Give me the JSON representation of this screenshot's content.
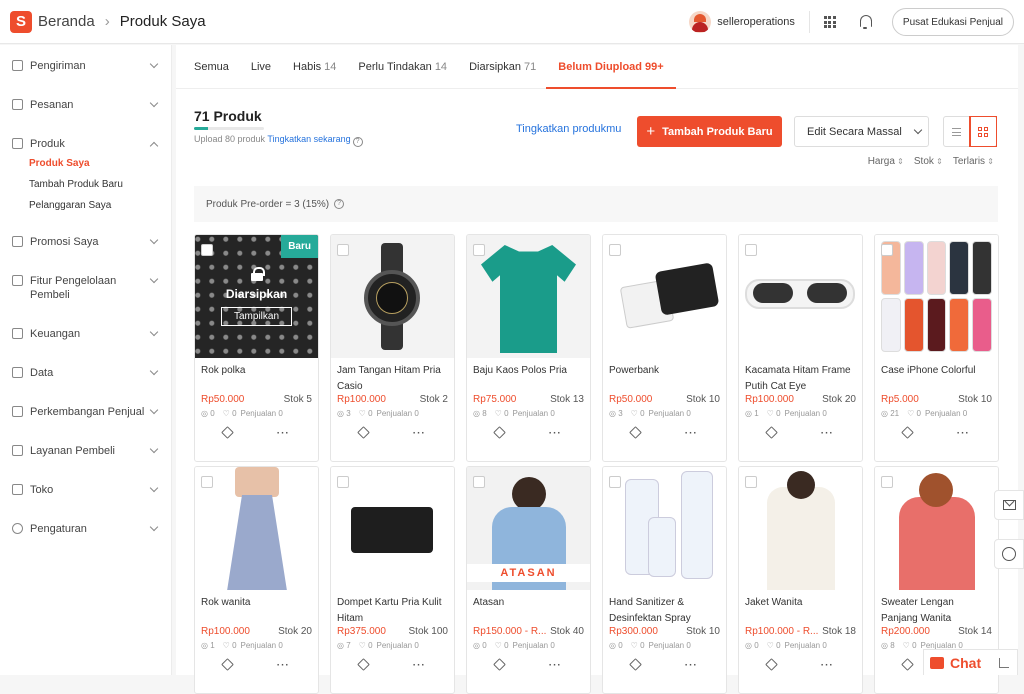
{
  "header": {
    "breadcrumb_home": "Beranda",
    "breadcrumb_current": "Produk Saya",
    "username": "selleroperations",
    "edu_button": "Pusat Edukasi Penjual"
  },
  "sidebar": {
    "items": [
      {
        "label": "Pengiriman"
      },
      {
        "label": "Pesanan"
      },
      {
        "label": "Produk",
        "sub": [
          "Produk Saya",
          "Tambah Produk Baru",
          "Pelanggaran Saya"
        ]
      },
      {
        "label": "Promosi Saya"
      },
      {
        "label": "Fitur Pengelolaan Pembeli"
      },
      {
        "label": "Keuangan"
      },
      {
        "label": "Data"
      },
      {
        "label": "Perkembangan Penjual"
      },
      {
        "label": "Layanan Pembeli"
      },
      {
        "label": "Toko"
      },
      {
        "label": "Pengaturan"
      }
    ]
  },
  "tabs": [
    {
      "label": "Semua",
      "count": ""
    },
    {
      "label": "Live",
      "count": ""
    },
    {
      "label": "Habis",
      "count": "14"
    },
    {
      "label": "Perlu Tindakan",
      "count": "14"
    },
    {
      "label": "Diarsipkan",
      "count": "71"
    },
    {
      "label": "Belum Diupload 99+",
      "count": ""
    }
  ],
  "summary": {
    "title": "71 Produk",
    "upload_progress": 0.2,
    "upload_text": "Upload 80 produk",
    "upgrade_link": "Tingkatkan sekarang",
    "upgrade_products": "Tingkatkan produkmu",
    "add_button": "Tambah Produk Baru",
    "mass_edit": "Edit Secara Massal",
    "sort": [
      "Harga",
      "Stok",
      "Terlaris"
    ],
    "preorder": "Produk Pre-order = 3 (15%)"
  },
  "archived": {
    "label": "Diarsipkan",
    "button": "Tampilkan",
    "badge": "Baru"
  },
  "products": [
    {
      "name": "Rok polka",
      "price": "Rp50.000",
      "stock": "Stok 5",
      "views": "0",
      "likes": "0",
      "sales": "Penjualan 0"
    },
    {
      "name": "Jam Tangan Hitam Pria Casio",
      "price": "Rp100.000",
      "stock": "Stok 2",
      "views": "3",
      "likes": "0",
      "sales": "Penjualan 0"
    },
    {
      "name": "Baju Kaos Polos Pria",
      "price": "Rp75.000",
      "stock": "Stok 13",
      "views": "8",
      "likes": "0",
      "sales": "Penjualan 0"
    },
    {
      "name": "Powerbank",
      "price": "Rp50.000",
      "stock": "Stok 10",
      "views": "3",
      "likes": "0",
      "sales": "Penjualan 0"
    },
    {
      "name": "Kacamata Hitam Frame Putih Cat Eye",
      "price": "Rp100.000",
      "stock": "Stok 20",
      "views": "1",
      "likes": "0",
      "sales": "Penjualan 0"
    },
    {
      "name": "Case iPhone Colorful",
      "price": "Rp5.000",
      "stock": "Stok 10",
      "views": "21",
      "likes": "0",
      "sales": "Penjualan 0"
    },
    {
      "name": "Rok wanita",
      "price": "Rp100.000",
      "stock": "Stok 20",
      "views": "1",
      "likes": "0",
      "sales": "Penjualan 0"
    },
    {
      "name": "Dompet Kartu Pria Kulit Hitam",
      "price": "Rp375.000",
      "stock": "Stok 100",
      "views": "7",
      "likes": "0",
      "sales": "Penjualan 0"
    },
    {
      "name": "Atasan",
      "price": "Rp150.000 - R...",
      "stock": "Stok 40",
      "views": "0",
      "likes": "0",
      "sales": "Penjualan 0"
    },
    {
      "name": "Hand Sanitizer & Desinfektan Spray",
      "price": "Rp300.000",
      "stock": "Stok 10",
      "views": "0",
      "likes": "0",
      "sales": "Penjualan 0"
    },
    {
      "name": "Jaket Wanita",
      "price": "Rp100.000 - R...",
      "stock": "Stok 18",
      "views": "0",
      "likes": "0",
      "sales": "Penjualan 0"
    },
    {
      "name": "Sweater Lengan Panjang Wanita",
      "price": "Rp200.000",
      "stock": "Stok 14",
      "views": "8",
      "likes": "0",
      "sales": "Penjualan 0"
    }
  ],
  "atasan_overlay": "ATASAN",
  "chat": {
    "label": "Chat"
  }
}
